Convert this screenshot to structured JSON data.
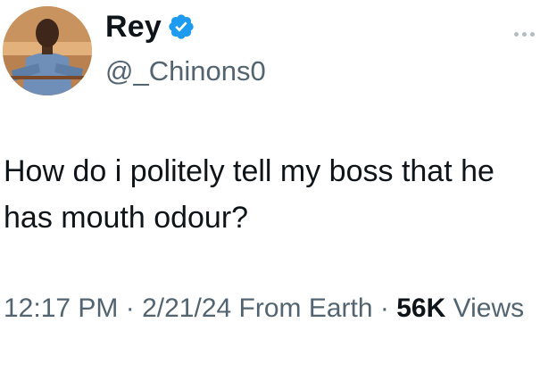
{
  "author": {
    "display_name": "Rey",
    "handle": "@_Chinons0",
    "verified_icon": "verified-badge-icon",
    "badge_color": "#1d9bf0"
  },
  "tweet": {
    "text": "How do i politely tell my boss that he has mouth odour?"
  },
  "meta": {
    "time": "12:17 PM",
    "separator1": " · ",
    "date": "2/21/24",
    "source": "From Earth",
    "separator2": " · ",
    "views_count": "56K",
    "views_label": "Views"
  },
  "more_icon": "more-options-icon"
}
